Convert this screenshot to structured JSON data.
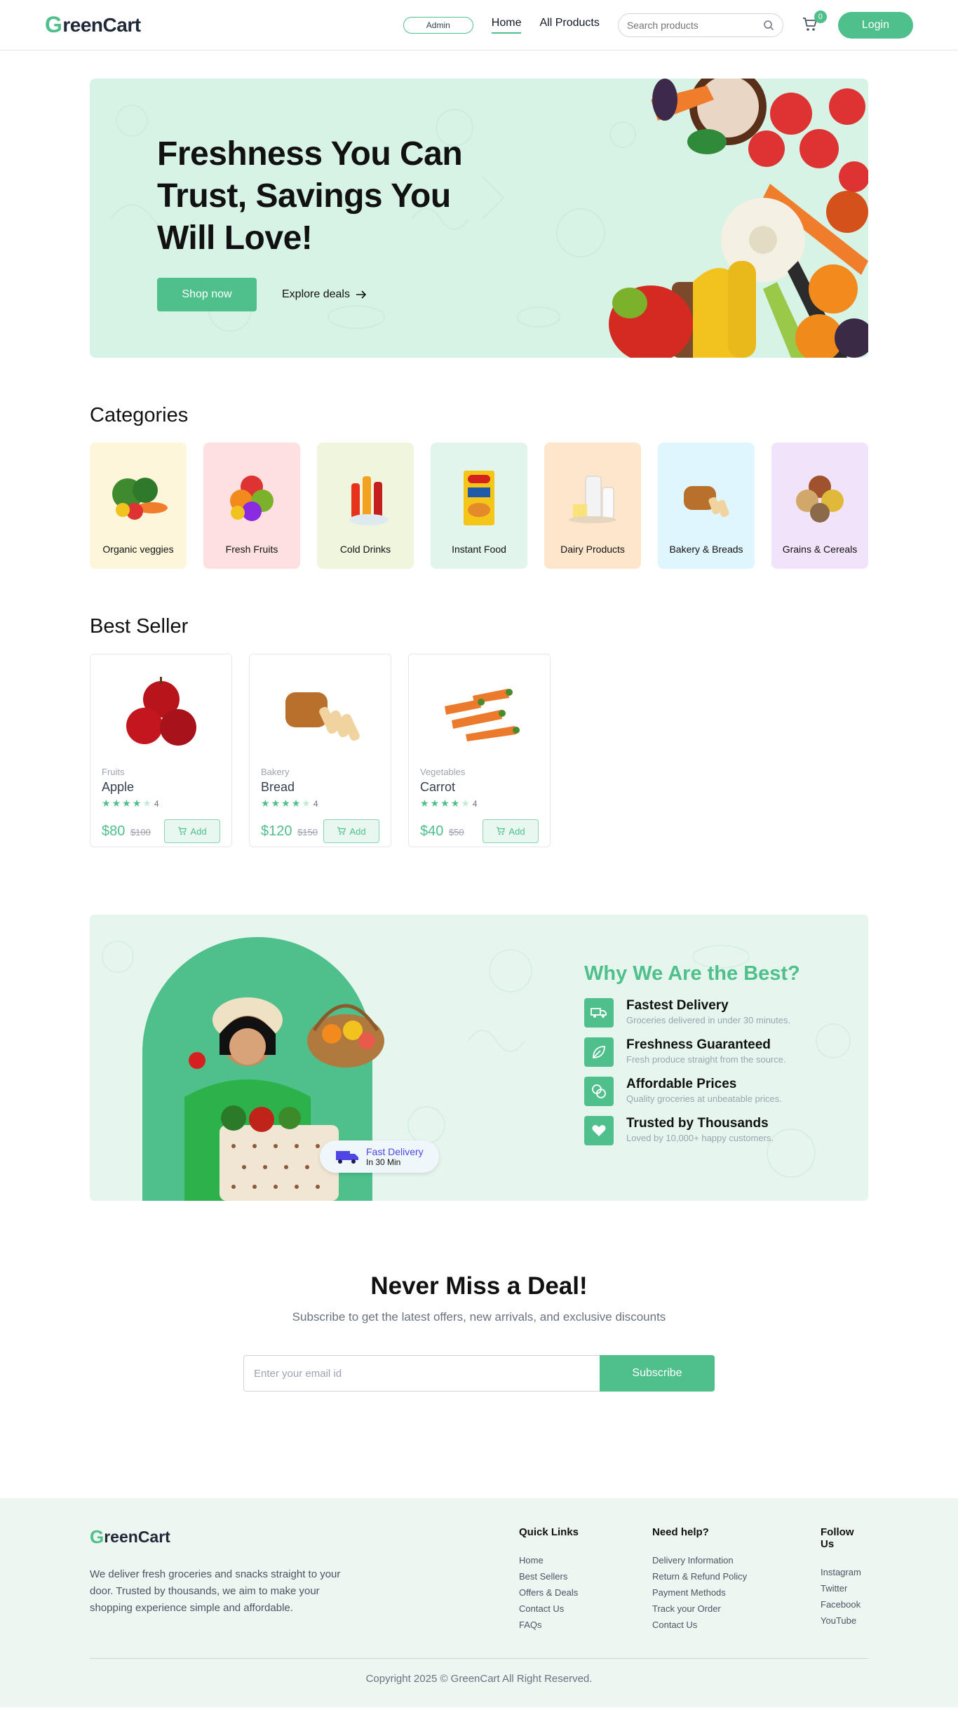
{
  "brand": {
    "logo_first": "G",
    "logo_rest": "reenCart"
  },
  "nav": {
    "admin_label": "Admin",
    "links": [
      {
        "label": "Home",
        "active": true
      },
      {
        "label": "All Products",
        "active": false
      }
    ],
    "search_placeholder": "Search products",
    "cart_count": "0",
    "login_label": "Login"
  },
  "hero": {
    "title": "Freshness You Can Trust, Savings You Will Love!",
    "shop_label": "Shop now",
    "explore_label": "Explore deals"
  },
  "categories": {
    "title": "Categories",
    "items": [
      {
        "label": "Organic veggies",
        "bg": "#FEF6DA",
        "icon": "veggies-icon"
      },
      {
        "label": "Fresh Fruits",
        "bg": "#FEE0E0",
        "icon": "fruits-icon"
      },
      {
        "label": "Cold Drinks",
        "bg": "#F0F5DE",
        "icon": "drinks-icon"
      },
      {
        "label": "Instant Food",
        "bg": "#E1F5EC",
        "icon": "noodles-icon"
      },
      {
        "label": "Dairy Products",
        "bg": "#FEE6CD",
        "icon": "dairy-icon"
      },
      {
        "label": "Bakery & Breads",
        "bg": "#E0F6FE",
        "icon": "bread-icon"
      },
      {
        "label": "Grains & Cereals",
        "bg": "#F1E3F9",
        "icon": "grains-icon"
      }
    ]
  },
  "best_seller": {
    "title": "Best Seller",
    "products": [
      {
        "category": "Fruits",
        "name": "Apple",
        "rating": 4,
        "rating_label": "4",
        "price": "$80",
        "old_price": "$100",
        "add_label": "Add"
      },
      {
        "category": "Bakery",
        "name": "Bread",
        "rating": 4,
        "rating_label": "4",
        "price": "$120",
        "old_price": "$150",
        "add_label": "Add"
      },
      {
        "category": "Vegetables",
        "name": "Carrot",
        "rating": 4,
        "rating_label": "4",
        "price": "$40",
        "old_price": "$50",
        "add_label": "Add"
      }
    ]
  },
  "why": {
    "title": "Why We Are the Best?",
    "badge_title": "Fast Delivery",
    "badge_sub": "In 30 Min",
    "features": [
      {
        "title": "Fastest Delivery",
        "desc": "Groceries delivered in under 30 minutes.",
        "icon": "truck-icon"
      },
      {
        "title": "Freshness Guaranteed",
        "desc": "Fresh produce straight from the source.",
        "icon": "leaf-icon"
      },
      {
        "title": "Affordable Prices",
        "desc": "Quality groceries at unbeatable prices.",
        "icon": "coins-icon"
      },
      {
        "title": "Trusted by Thousands",
        "desc": "Loved by 10,000+ happy customers.",
        "icon": "heart-icon"
      }
    ]
  },
  "newsletter": {
    "title": "Never Miss a Deal!",
    "subtitle": "Subscribe to get the latest offers, new arrivals, and exclusive discounts",
    "placeholder": "Enter your email id",
    "button": "Subscribe"
  },
  "footer": {
    "description": "We deliver fresh groceries and snacks straight to your door. Trusted by thousands, we aim to make your shopping experience simple and affordable.",
    "columns": [
      {
        "title": "Quick Links",
        "items": [
          "Home",
          "Best Sellers",
          "Offers & Deals",
          "Contact Us",
          "FAQs"
        ]
      },
      {
        "title": "Need help?",
        "items": [
          "Delivery Information",
          "Return & Refund Policy",
          "Payment Methods",
          "Track your Order",
          "Contact Us"
        ]
      },
      {
        "title": "Follow Us",
        "items": [
          "Instagram",
          "Twitter",
          "Facebook",
          "YouTube"
        ]
      }
    ],
    "copyright": "Copyright 2025 © GreenCart All Right Reserved."
  },
  "colors": {
    "accent": "#4FBF8B",
    "hero_bg": "#D7F3E6",
    "footer_bg": "#EDF6F1"
  }
}
